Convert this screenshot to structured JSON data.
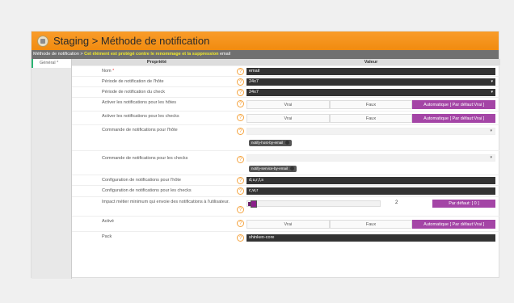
{
  "header": {
    "title": "Staging > Méthode de notification"
  },
  "breadcrumb": {
    "prefix": "Méthode de notification >",
    "warning": "Cet élément est protégé contre le renommage et la suppression",
    "suffix": "email"
  },
  "tabs": [
    {
      "label": "Général *"
    }
  ],
  "table": {
    "col_property": "Propriété",
    "col_value": "Valeur"
  },
  "fields": {
    "name": {
      "label": "Nom",
      "required": "*",
      "value": "email"
    },
    "host_period": {
      "label": "Période de notification de l'hôte",
      "value": "24x7"
    },
    "check_period": {
      "label": "Période de notification du check",
      "value": "24x7"
    },
    "host_enabled": {
      "label": "Activer les notifications pour les hôtes",
      "opt_true": "Vrai",
      "opt_false": "Faux",
      "opt_auto": "Automatique [ Par défaut:Vrai ]"
    },
    "check_enabled": {
      "label": "Activer les notifications pour les checks",
      "opt_true": "Vrai",
      "opt_false": "Faux",
      "opt_auto": "Automatique [ Par défaut:Vrai ]"
    },
    "host_command": {
      "label": "Commande de notifications pour l'hôte",
      "chip": "notify-host-by-email"
    },
    "check_command": {
      "label": "Commande de notifications pour les checks",
      "chip": "notify-service-by-email"
    },
    "host_options": {
      "label": "Configuration de notifications pour l'hôte",
      "value": "d,u,r,f,s"
    },
    "check_options": {
      "label": "Configuration de notifications pour les checks",
      "value": "c,w,r"
    },
    "min_impact": {
      "label": "Impact métier minimum qui envoie des notifications à l'utilisateur.",
      "value": "2",
      "level": 0.05,
      "default_label": "Par défaut: [ 0 ]"
    },
    "active": {
      "label": "Activé",
      "opt_true": "Vrai",
      "opt_false": "Faux",
      "opt_auto": "Automatique [ Par défaut:Vrai ]"
    },
    "pack": {
      "label": "Pack",
      "value": "shinken-core"
    }
  },
  "help_glyph": "?",
  "dropdown_glyph": "▾",
  "colors": {
    "header": "#f39019",
    "accent": "#a445a6",
    "input_bg": "#333333",
    "help": "#f5a440"
  }
}
